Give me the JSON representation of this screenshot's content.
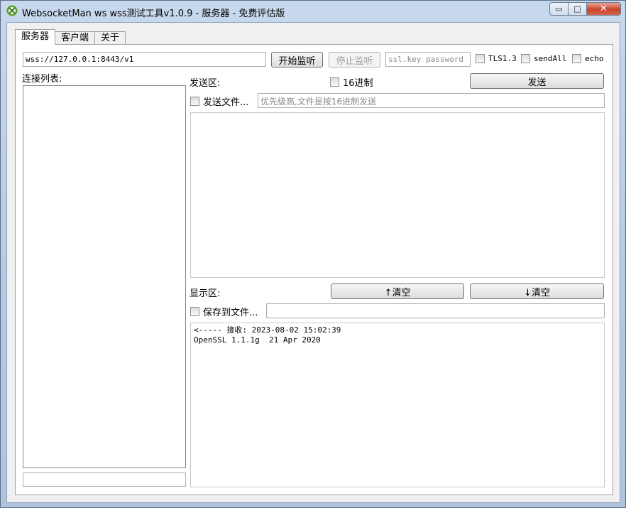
{
  "window": {
    "title": "WebsocketMan ws wss测试工具v1.0.9  - 服务器 - 免费评估版",
    "min_glyph": "▭",
    "max_glyph": "□",
    "close_glyph": "✕"
  },
  "tabs": [
    {
      "label": "服务器",
      "active": true
    },
    {
      "label": "客户端",
      "active": false
    },
    {
      "label": "关于",
      "active": false
    }
  ],
  "server": {
    "url_value": "wss://127.0.0.1:8443/v1",
    "start_label": "开始监听",
    "stop_label": "停止监听",
    "ssl_placeholder": "ssl.key password",
    "tls_label": "TLS1.3",
    "sendall_label": "sendAll",
    "echo_label": "echo"
  },
  "connections": {
    "label": "连接列表:"
  },
  "send": {
    "label": "发送区:",
    "hex_label": "16进制",
    "send_button": "发送",
    "file_label": "发送文件...",
    "file_placeholder": "优先级高,文件是按16进制发送"
  },
  "display": {
    "label": "显示区:",
    "clear_up": "↑清空",
    "clear_down": "↓清空",
    "save_label": "保存到文件...",
    "log_lines": [
      "<----- 接收: 2023-08-02 15:02:39",
      "OpenSSL 1.1.1g  21 Apr 2020"
    ]
  }
}
